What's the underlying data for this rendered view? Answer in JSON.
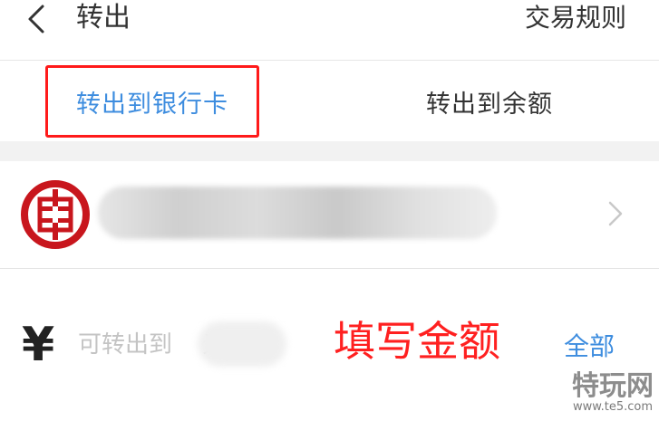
{
  "header": {
    "back_icon": "chevron-left-icon",
    "title": "转出",
    "rules_label": "交易规则"
  },
  "tabs": [
    {
      "label": "转出到银行卡",
      "active": true
    },
    {
      "label": "转出到余额",
      "active": false
    }
  ],
  "bank_card": {
    "logo_icon": "icbc-bank-logo",
    "name": "",
    "chevron_icon": "chevron-right-icon"
  },
  "amount": {
    "currency_symbol": "¥",
    "placeholder": "可转出到    元",
    "annotation": "填写金额",
    "all_label": "全部"
  },
  "watermark": {
    "main": "特玩网",
    "sub": "www.te5.com"
  },
  "colors": {
    "accent_blue": "#3e8ddf",
    "highlight_red": "#ff1a1a",
    "bank_red": "#c8161d"
  }
}
